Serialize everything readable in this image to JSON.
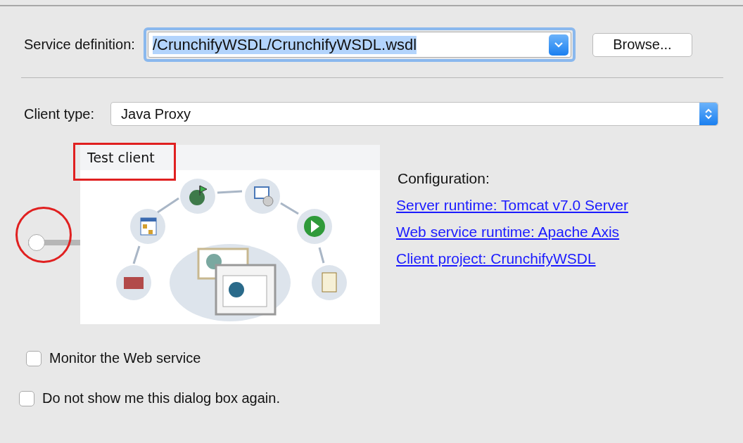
{
  "service_definition": {
    "label": "Service definition:",
    "value": "/CrunchifyWSDL/CrunchifyWSDL.wsdl",
    "selected_text": true
  },
  "browse_button": "Browse...",
  "client_type": {
    "label": "Client type:",
    "value": "Java Proxy"
  },
  "slider": {
    "level": 0,
    "label": "Test client"
  },
  "configuration": {
    "title": "Configuration:",
    "links": [
      "Server runtime: Tomcat v7.0 Server",
      "Web service runtime: Apache Axis",
      "Client project: CrunchifyWSDL"
    ]
  },
  "checkboxes": [
    {
      "label": "Monitor the Web service",
      "checked": false
    },
    {
      "label": "Do not show me this dialog box again.",
      "checked": false
    }
  ]
}
